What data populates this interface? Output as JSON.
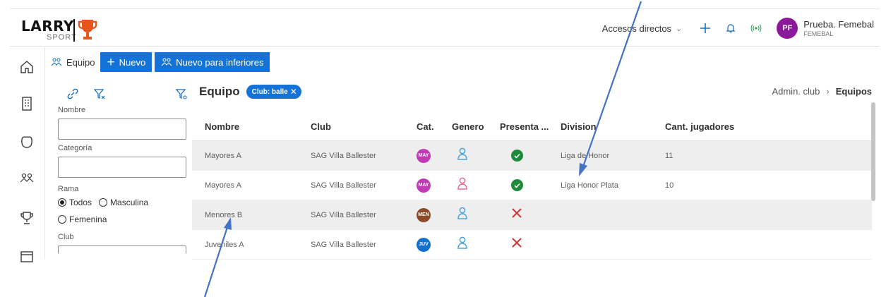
{
  "header": {
    "logo_text": "LARRY",
    "logo_sub": "SPORT",
    "accesos": "Accesos directos",
    "user_initials": "PF",
    "user_name": "Prueba. Femebal",
    "user_org": "FEMEBAL"
  },
  "rail_icons": [
    "home-icon",
    "building-icon",
    "shield-icon",
    "team-icon",
    "trophy-icon",
    "calendar-icon"
  ],
  "toolbar": {
    "section_label": "Equipo",
    "new_label": "Nuevo",
    "new_inferior_label": "Nuevo para inferiores"
  },
  "filters": {
    "nombre_label": "Nombre",
    "categoria_label": "Categoría",
    "rama_label": "Rama",
    "rama_options": [
      "Todos",
      "Masculina",
      "Femenina"
    ],
    "rama_selected": "Todos",
    "club_label": "Club"
  },
  "main": {
    "title": "Equipo",
    "chip_label": "Club: balle",
    "breadcrumb": [
      "Admin. club",
      "Equipos"
    ]
  },
  "table": {
    "headers": [
      "Nombre",
      "Club",
      "Cat.",
      "Genero",
      "Presenta ...",
      "Division",
      "Cant. jugadores"
    ],
    "rows": [
      {
        "nombre": "Mayores A",
        "club": "SAG Villa Ballester",
        "cat": "MAY",
        "cat_color": "#c13ab6",
        "genero_color": "#4aa3df",
        "presenta": "check",
        "division": "Liga de Honor",
        "cant": "11"
      },
      {
        "nombre": "Mayores A",
        "club": "SAG Villa Ballester",
        "cat": "MAY",
        "cat_color": "#c13ab6",
        "genero_color": "#ef6b8f",
        "presenta": "check",
        "division": "Liga Honor Plata",
        "cant": "10"
      },
      {
        "nombre": "Menores B",
        "club": "SAG Villa Ballester",
        "cat": "MEN",
        "cat_color": "#8a4b2a",
        "genero_color": "#4aa3df",
        "presenta": "cross",
        "division": "",
        "cant": ""
      },
      {
        "nombre": "Juveniles A",
        "club": "SAG Villa Ballester",
        "cat": "JUV",
        "cat_color": "#1570cc",
        "genero_color": "#4aa3df",
        "presenta": "cross",
        "division": "",
        "cant": ""
      }
    ]
  },
  "colors": {
    "primary": "#1573d8",
    "check_green": "#1f8a3c",
    "cross_red": "#d13438",
    "avatar": "#8b1a9b"
  }
}
